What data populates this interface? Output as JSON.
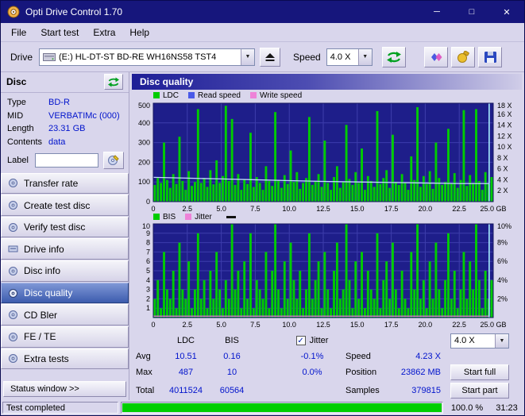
{
  "window": {
    "title": "Opti Drive Control 1.70"
  },
  "menu": {
    "items": [
      "File",
      "Start test",
      "Extra",
      "Help"
    ]
  },
  "toolbar": {
    "drive_label": "Drive",
    "drive_value": "(E:)  HL-DT-ST BD-RE  WH16NS58 TST4",
    "speed_label": "Speed",
    "speed_value": "4.0 X"
  },
  "disc": {
    "header": "Disc",
    "fields": [
      {
        "label": "Type",
        "value": "BD-R"
      },
      {
        "label": "MID",
        "value": "VERBATIMc (000)"
      },
      {
        "label": "Length",
        "value": "23.31 GB"
      },
      {
        "label": "Contents",
        "value": "data"
      }
    ],
    "label_label": "Label",
    "label_value": ""
  },
  "sidebar": {
    "items": [
      {
        "label": "Transfer rate",
        "active": false
      },
      {
        "label": "Create test disc",
        "active": false
      },
      {
        "label": "Verify test disc",
        "active": false
      },
      {
        "label": "Drive info",
        "active": false
      },
      {
        "label": "Disc info",
        "active": false
      },
      {
        "label": "Disc quality",
        "active": true
      },
      {
        "label": "CD Bler",
        "active": false
      },
      {
        "label": "FE / TE",
        "active": false
      },
      {
        "label": "Extra tests",
        "active": false
      }
    ],
    "status_button": "Status window >>"
  },
  "chart_header": {
    "title": "Disc quality"
  },
  "legend_top": [
    {
      "label": "LDC",
      "color": "#00cc00"
    },
    {
      "label": "Read speed",
      "color": "#4a5ae8"
    },
    {
      "label": "Write speed",
      "color": "#ee82d8"
    }
  ],
  "legend_bottom": [
    {
      "label": "BIS",
      "color": "#00cc00"
    },
    {
      "label": "Jitter",
      "color": "#ee82d8"
    }
  ],
  "chart_data": [
    {
      "type": "bar",
      "name": "LDC with read speed overlay",
      "bg": "#1e1e8a",
      "grid": "#3d3dac",
      "y_left": {
        "max": 500,
        "ticks": [
          500,
          400,
          300,
          200,
          100,
          0
        ]
      },
      "y_right": {
        "max": 18,
        "unit": " X",
        "ticks": [
          18,
          16,
          14,
          12,
          10,
          8,
          6,
          4,
          2
        ]
      },
      "x": {
        "max": 25,
        "labels": [
          "0",
          "2.5",
          "5.0",
          "7.5",
          "10.0",
          "12.5",
          "15.0",
          "17.5",
          "20.0",
          "22.5",
          "25.0 GB"
        ]
      },
      "bars": {
        "name": "LDC",
        "color": "#00cc00",
        "values": [
          85,
          120,
          95,
          300,
          110,
          70,
          140,
          90,
          330,
          105,
          60,
          155,
          80,
          100,
          470,
          95,
          120,
          75,
          160,
          88,
          210,
          95,
          130,
          487,
          105,
          420,
          85,
          140,
          60,
          115,
          90,
          350,
          75,
          125,
          95,
          60,
          180,
          105,
          80,
          455,
          110,
          70,
          135,
          90,
          260,
          100,
          150,
          65,
          95,
          120,
          430,
          85,
          105,
          140,
          75,
          310,
          95,
          60,
          125,
          180,
          70,
          100,
          390,
          115,
          85,
          150,
          95,
          270,
          60,
          130,
          105,
          75,
          460,
          90,
          120,
          160,
          70,
          340,
          100,
          85,
          140,
          95,
          60,
          230,
          110,
          480,
          75,
          130,
          90,
          155,
          65,
          300,
          120,
          85,
          100,
          370,
          95,
          145,
          70,
          110,
          465,
          80,
          135,
          95,
          470,
          105,
          60,
          150,
          90,
          125
        ]
      },
      "lines": [
        {
          "name": "Read speed",
          "color": "#c4daff",
          "axis": "right",
          "x": [
            0,
            2.5,
            5,
            7.5,
            10,
            12.5,
            15,
            17.5,
            20,
            22.5,
            24.7
          ],
          "values": [
            4.45,
            4.3,
            4.15,
            4.0,
            3.85,
            3.7,
            3.6,
            3.5,
            3.4,
            3.3,
            3.3
          ]
        },
        {
          "name": "Write speed",
          "color": "#ee82d8",
          "axis": "right",
          "x": [],
          "values": []
        }
      ],
      "end_marker": {
        "x_gb": 24.7,
        "color": "#a8f0ff"
      }
    },
    {
      "type": "bar",
      "name": "BIS with jitter overlay",
      "bg": "#1e1e8a",
      "grid": "#3d3dac",
      "y_left": {
        "max": 10,
        "ticks": [
          10,
          9,
          8,
          7,
          6,
          5,
          4,
          3,
          2,
          1
        ]
      },
      "y_right": {
        "max": 10,
        "unit": "%",
        "ticks": [
          10,
          8,
          6,
          4,
          2
        ]
      },
      "x": {
        "max": 25,
        "labels": [
          "0",
          "2.5",
          "5.0",
          "7.5",
          "10.0",
          "12.5",
          "15.0",
          "17.5",
          "20.0",
          "22.5",
          "25.0 GB"
        ]
      },
      "bars": {
        "name": "BIS",
        "color": "#00cc00",
        "values": [
          2,
          4,
          1,
          7,
          3,
          2,
          5,
          1,
          8,
          3,
          2,
          6,
          1,
          3,
          9,
          2,
          4,
          1,
          5,
          2,
          7,
          3,
          1,
          4,
          2,
          10,
          3,
          5,
          1,
          6,
          2,
          9,
          1,
          4,
          3,
          2,
          7,
          1,
          5,
          10,
          3,
          1,
          6,
          2,
          8,
          4,
          2,
          5,
          1,
          3,
          9,
          2,
          4,
          6,
          1,
          7,
          3,
          1,
          5,
          8,
          2,
          3,
          10,
          4,
          1,
          6,
          2,
          7,
          1,
          5,
          3,
          2,
          9,
          1,
          4,
          6,
          2,
          8,
          3,
          1,
          5,
          2,
          1,
          7,
          3,
          10,
          2,
          4,
          1,
          6,
          2,
          8,
          3,
          1,
          4,
          9,
          2,
          5,
          1,
          3,
          7,
          2,
          6,
          3,
          10,
          4,
          1,
          5,
          2,
          4
        ]
      },
      "lines": [
        {
          "name": "Jitter",
          "color": "#ee82d8",
          "axis": "right",
          "x": [
            0,
            2.5,
            5,
            7.5,
            10,
            12.5,
            15,
            17.5,
            20,
            22.5,
            24.7
          ],
          "values": [
            0.15,
            0.15,
            0.15,
            0.15,
            0.15,
            0.15,
            0.15,
            0.15,
            0.15,
            0.15,
            0.15
          ]
        }
      ],
      "end_marker": {
        "x_gb": 24.7,
        "color": "#a8f0ff"
      }
    }
  ],
  "summary": {
    "col_headers": [
      "LDC",
      "BIS"
    ],
    "jitter_label": "Jitter",
    "jitter_checked": true,
    "rows": [
      {
        "label": "Avg",
        "ldc": "10.51",
        "bis": "0.16",
        "jitter": "-0.1%"
      },
      {
        "label": "Max",
        "ldc": "487",
        "bis": "10",
        "jitter": "0.0%"
      },
      {
        "label": "Total",
        "ldc": "4011524",
        "bis": "60564",
        "jitter": ""
      }
    ],
    "right": [
      {
        "label": "Speed",
        "value": "4.23 X"
      },
      {
        "label": "Position",
        "value": "23862 MB"
      },
      {
        "label": "Samples",
        "value": "379815"
      }
    ]
  },
  "controls": {
    "speed_value": "4.0 X",
    "start_full": "Start full",
    "start_part": "Start part"
  },
  "statusbar": {
    "status": "Test completed",
    "percent": "100.0 %",
    "time": "31:23",
    "progress": 100
  }
}
